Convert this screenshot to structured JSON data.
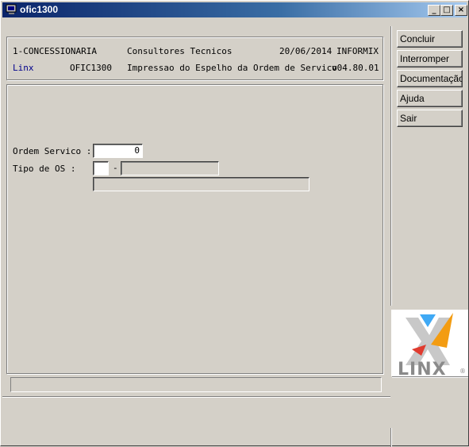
{
  "window": {
    "title": "ofic1300",
    "minimize": "_",
    "maximize": "□",
    "close": "×"
  },
  "header": {
    "company": "1-CONCESSIONARIA",
    "module_name": "Consultores Tecnicos",
    "date": "20/06/2014",
    "db": "INFORMIX",
    "brand": "Linx",
    "program": "OFIC1300",
    "description": "Impressao do Espelho da Ordem de Servico",
    "version": "v04.80.01"
  },
  "buttons": {
    "concluir": "Concluir",
    "interromper": "Interromper",
    "documentacao": "Documentação",
    "ajuda": "Ajuda",
    "sair": "Sair"
  },
  "form": {
    "ordem_servico": {
      "label": "Ordem Servico :",
      "value": "0"
    },
    "tipo_os": {
      "label": "Tipo de OS    :",
      "code": "",
      "separator": "-",
      "description": "",
      "extra": ""
    }
  },
  "status": {
    "text": ""
  },
  "logo": {
    "text": "LINX",
    "registered": "®",
    "colors": {
      "orange": "#f39c12",
      "blue": "#3fa9f5",
      "red": "#e03b2f",
      "gray": "#8a8a8a"
    }
  }
}
